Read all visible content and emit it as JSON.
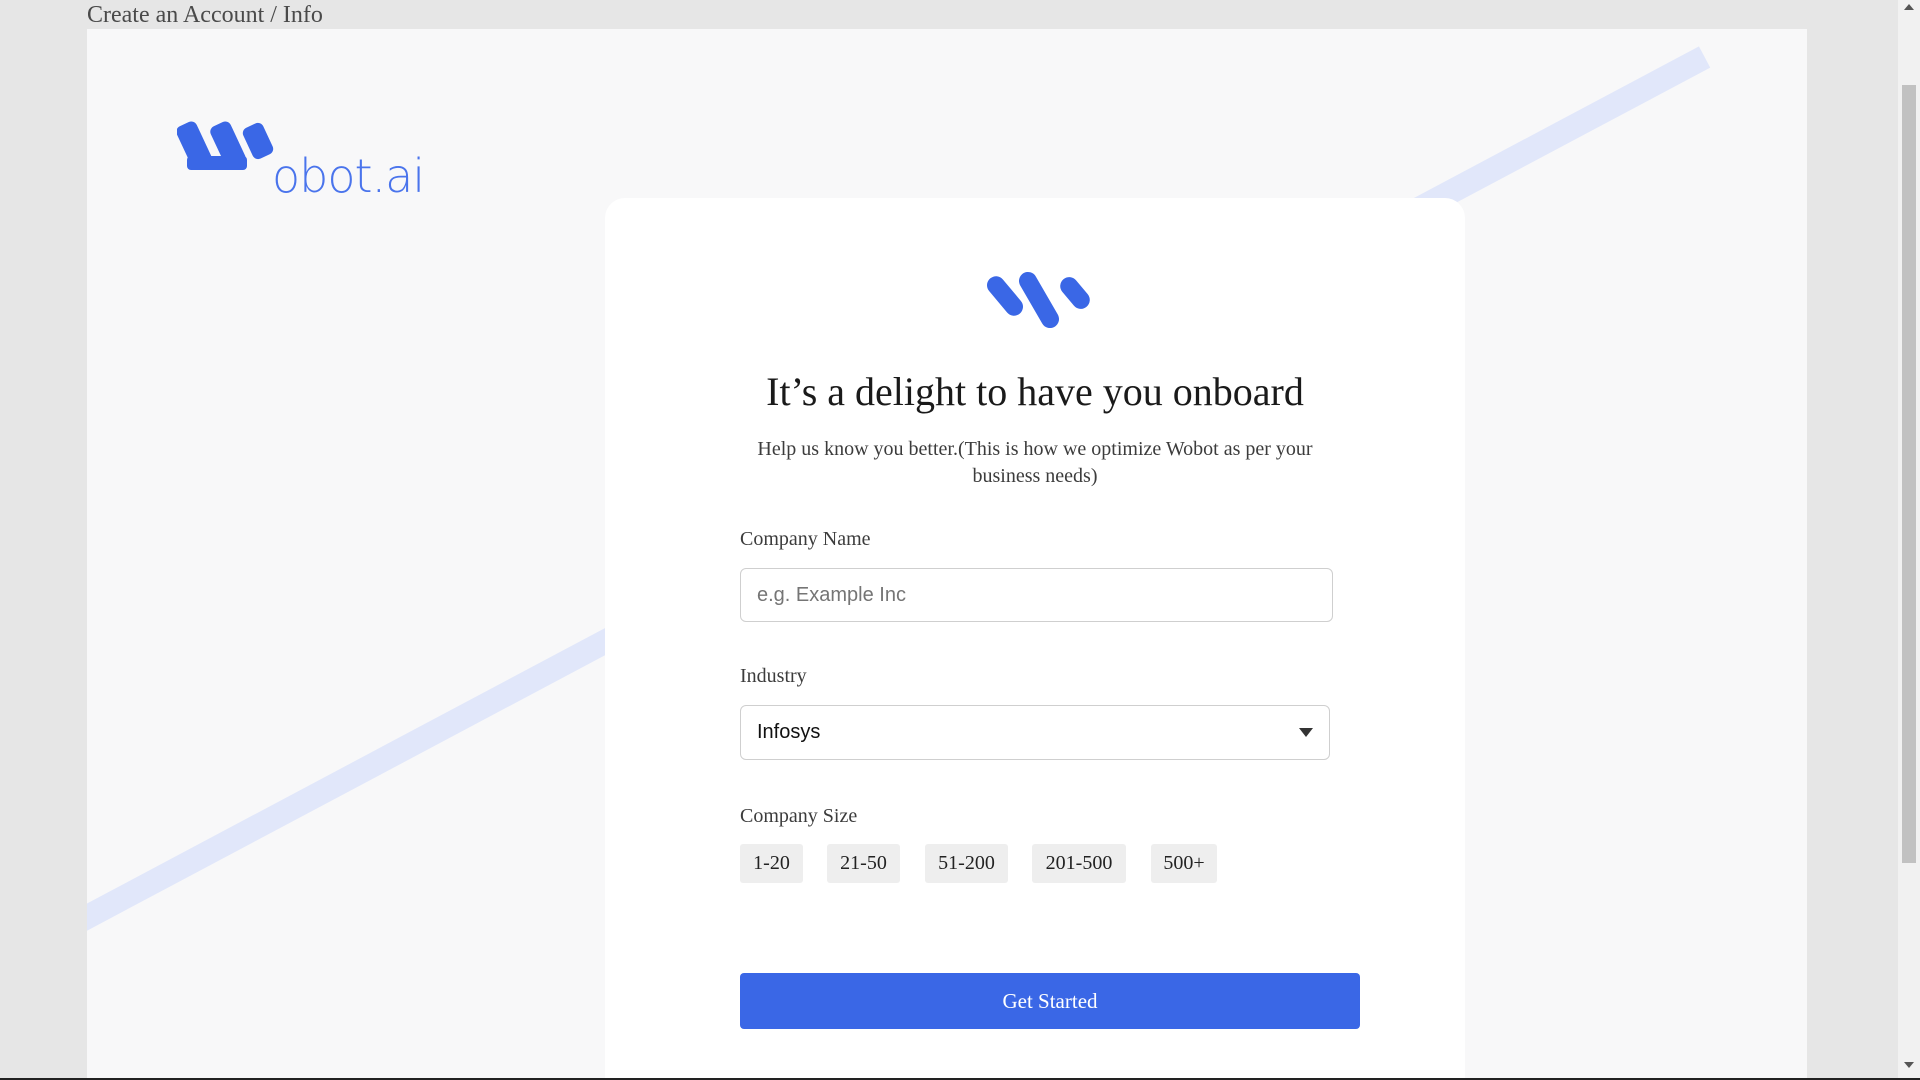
{
  "breadcrumb": "Create an Account / Info",
  "brand": {
    "wordmark": "obot.ai",
    "logo_icon": "wobot-logo-icon",
    "color": "#4a74ec"
  },
  "card": {
    "logo_icon": "wobot-mark-icon",
    "title": "It’s a delight to have you onboard",
    "subtitle": "Help us know you better.(This is how we optimize Wobot as per your business needs)"
  },
  "form": {
    "company_name": {
      "label": "Company Name",
      "value": "",
      "placeholder": "e.g. Example Inc"
    },
    "industry": {
      "label": "Industry",
      "selected": "Infosys"
    },
    "company_size": {
      "label": "Company Size",
      "options": [
        "1-20",
        "21-50",
        "51-200",
        "201-500",
        "500+"
      ]
    },
    "submit_label": "Get Started"
  },
  "colors": {
    "accent": "#3a67e6",
    "page_bg": "#f8f8f9",
    "stripe": "#e1e7fa"
  }
}
